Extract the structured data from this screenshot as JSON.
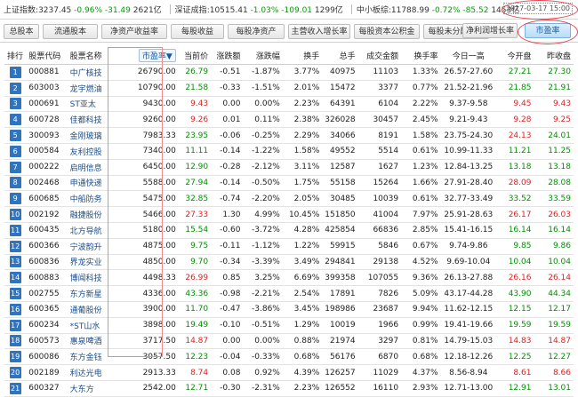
{
  "ticker": [
    {
      "name": "上证指数",
      "value": "3237.45",
      "pct": "-0.96%",
      "chg": "-31.49",
      "amount": "2621亿"
    },
    {
      "name": "深证成指",
      "value": "10515.41",
      "pct": "-1.03%",
      "chg": "-109.01",
      "amount": "1299亿"
    },
    {
      "name": "中小板综",
      "value": "11788.99",
      "pct": "-0.72%",
      "chg": "-85.52",
      "amount": "1453亿"
    }
  ],
  "datetime": "2017-03-17 15:00",
  "tabs": [
    "总股本",
    "流通股本",
    "净资产收益率",
    "每股收益",
    "每股净资产",
    "主营收入增长率",
    "每股资本公积金",
    "每股未分配利润",
    "净利润增长率",
    "市盈率"
  ],
  "active_tab": "市盈率",
  "columns": [
    "排行",
    "股票代码",
    "股票名称",
    "市盈率",
    "当前价",
    "涨跌额",
    "涨跌幅",
    "换手",
    "总手",
    "成交金额",
    "换手率",
    "今日一高",
    "今开盘",
    "昨收盘"
  ],
  "sort_indicator": "▼",
  "colors": {
    "up": "#e02020",
    "down": "#009000",
    "accent": "#2f74c0",
    "highlight": "#e2414c"
  },
  "rows": [
    {
      "rank": "1",
      "code": "000881",
      "name": "中广核技",
      "pe": "26790.00",
      "price": "26.79",
      "chg": "-0.51",
      "pct": "-1.87%",
      "turnover": "3.77%",
      "vol": "40975",
      "amount": "11103",
      "rate": "1.33%",
      "range": "26.57-27.60",
      "open": "27.21",
      "prev": "27.30",
      "pc": "green",
      "oc": "green"
    },
    {
      "rank": "2",
      "code": "603003",
      "name": "龙宇燃油",
      "pe": "10790.00",
      "price": "21.58",
      "chg": "-0.33",
      "pct": "-1.51%",
      "turnover": "2.01%",
      "vol": "15472",
      "amount": "3377",
      "rate": "0.77%",
      "range": "21.52-21.96",
      "open": "21.85",
      "prev": "21.91",
      "pc": "green",
      "oc": "green"
    },
    {
      "rank": "3",
      "code": "000691",
      "name": "ST亚太",
      "pe": "9430.00",
      "price": "9.43",
      "chg": "0.00",
      "pct": "0.00%",
      "turnover": "2.23%",
      "vol": "64391",
      "amount": "6104",
      "rate": "2.22%",
      "range": "9.37-9.58",
      "open": "9.45",
      "prev": "9.43",
      "pc": "red",
      "oc": "red"
    },
    {
      "rank": "4",
      "code": "600728",
      "name": "佳都科技",
      "pe": "9260.00",
      "price": "9.26",
      "chg": "0.01",
      "pct": "0.11%",
      "turnover": "2.38%",
      "vol": "326028",
      "amount": "30457",
      "rate": "2.45%",
      "range": "9.21-9.43",
      "open": "9.28",
      "prev": "9.25",
      "pc": "red",
      "oc": "red"
    },
    {
      "rank": "5",
      "code": "300093",
      "name": "金刚玻璃",
      "pe": "7983.33",
      "price": "23.95",
      "chg": "-0.06",
      "pct": "-0.25%",
      "turnover": "2.29%",
      "vol": "34066",
      "amount": "8191",
      "rate": "1.58%",
      "range": "23.75-24.30",
      "open": "24.13",
      "prev": "24.01",
      "pc": "green",
      "oc": "red"
    },
    {
      "rank": "6",
      "code": "000584",
      "name": "友利控股",
      "pe": "7340.00",
      "price": "11.11",
      "chg": "-0.14",
      "pct": "-1.22%",
      "turnover": "1.58%",
      "vol": "49552",
      "amount": "5514",
      "rate": "0.61%",
      "range": "10.99-11.33",
      "open": "11.21",
      "prev": "11.25",
      "pc": "green",
      "oc": "green"
    },
    {
      "rank": "7",
      "code": "000222",
      "name": "启明信息",
      "pe": "6450.00",
      "price": "12.90",
      "chg": "-0.28",
      "pct": "-2.12%",
      "turnover": "3.11%",
      "vol": "12587",
      "amount": "1627",
      "rate": "1.23%",
      "range": "12.84-13.25",
      "open": "13.18",
      "prev": "13.18",
      "pc": "green",
      "oc": "green"
    },
    {
      "rank": "8",
      "code": "002468",
      "name": "申通快递",
      "pe": "5588.00",
      "price": "27.94",
      "chg": "-0.14",
      "pct": "-0.50%",
      "turnover": "1.75%",
      "vol": "55158",
      "amount": "15264",
      "rate": "1.66%",
      "range": "27.91-28.40",
      "open": "28.09",
      "prev": "28.08",
      "pc": "green",
      "oc": "red"
    },
    {
      "rank": "9",
      "code": "600685",
      "name": "中船防务",
      "pe": "5475.00",
      "price": "32.85",
      "chg": "-0.74",
      "pct": "-2.20%",
      "turnover": "2.05%",
      "vol": "30485",
      "amount": "10039",
      "rate": "0.61%",
      "range": "32.77-33.49",
      "open": "33.52",
      "prev": "33.59",
      "pc": "green",
      "oc": "green"
    },
    {
      "rank": "10",
      "code": "002192",
      "name": "融捷股份",
      "pe": "5466.00",
      "price": "27.33",
      "chg": "1.30",
      "pct": "4.99%",
      "turnover": "10.45%",
      "vol": "151850",
      "amount": "41004",
      "rate": "7.97%",
      "range": "25.91-28.63",
      "open": "26.17",
      "prev": "26.03",
      "pc": "red",
      "oc": "red"
    },
    {
      "rank": "11",
      "code": "600435",
      "name": "北方导航",
      "pe": "5180.00",
      "price": "15.54",
      "chg": "-0.60",
      "pct": "-3.72%",
      "turnover": "4.28%",
      "vol": "425854",
      "amount": "66836",
      "rate": "2.85%",
      "range": "15.41-16.15",
      "open": "16.14",
      "prev": "16.14",
      "pc": "green",
      "oc": "green"
    },
    {
      "rank": "12",
      "code": "600366",
      "name": "宁波韵升",
      "pe": "4875.00",
      "price": "9.75",
      "chg": "-0.11",
      "pct": "-1.12%",
      "turnover": "1.22%",
      "vol": "59915",
      "amount": "5846",
      "rate": "0.67%",
      "range": "9.74-9.86",
      "open": "9.85",
      "prev": "9.86",
      "pc": "green",
      "oc": "green"
    },
    {
      "rank": "13",
      "code": "600836",
      "name": "界龙实业",
      "pe": "4850.00",
      "price": "9.70",
      "chg": "-0.34",
      "pct": "-3.39%",
      "turnover": "3.49%",
      "vol": "294841",
      "amount": "29138",
      "rate": "4.52%",
      "range": "9.69-10.04",
      "open": "10.04",
      "prev": "10.04",
      "pc": "green",
      "oc": "green"
    },
    {
      "rank": "14",
      "code": "600883",
      "name": "博闻科技",
      "pe": "4498.33",
      "price": "26.99",
      "chg": "0.85",
      "pct": "3.25%",
      "turnover": "6.69%",
      "vol": "399358",
      "amount": "107055",
      "rate": "9.36%",
      "range": "26.13-27.88",
      "open": "26.16",
      "prev": "26.14",
      "pc": "red",
      "oc": "red"
    },
    {
      "rank": "15",
      "code": "002755",
      "name": "东方新星",
      "pe": "4336.00",
      "price": "43.36",
      "chg": "-0.98",
      "pct": "-2.21%",
      "turnover": "2.54%",
      "vol": "17891",
      "amount": "7826",
      "rate": "5.09%",
      "range": "43.17-44.28",
      "open": "43.90",
      "prev": "44.34",
      "pc": "green",
      "oc": "green"
    },
    {
      "rank": "16",
      "code": "600365",
      "name": "通葡股份",
      "pe": "3900.00",
      "price": "11.70",
      "chg": "-0.47",
      "pct": "-3.86%",
      "turnover": "3.45%",
      "vol": "198986",
      "amount": "23687",
      "rate": "9.94%",
      "range": "11.62-12.15",
      "open": "12.15",
      "prev": "12.17",
      "pc": "green",
      "oc": "green"
    },
    {
      "rank": "17",
      "code": "600234",
      "name": "*ST山水",
      "pe": "3898.00",
      "price": "19.49",
      "chg": "-0.10",
      "pct": "-0.51%",
      "turnover": "1.29%",
      "vol": "10019",
      "amount": "1966",
      "rate": "0.99%",
      "range": "19.41-19.66",
      "open": "19.59",
      "prev": "19.59",
      "pc": "green",
      "oc": "green"
    },
    {
      "rank": "18",
      "code": "600573",
      "name": "惠泉啤酒",
      "pe": "3717.50",
      "price": "14.87",
      "chg": "0.00",
      "pct": "0.00%",
      "turnover": "0.88%",
      "vol": "21974",
      "amount": "3297",
      "rate": "0.81%",
      "range": "14.79-15.03",
      "open": "14.83",
      "prev": "14.87",
      "pc": "red",
      "oc": "red"
    },
    {
      "rank": "19",
      "code": "600086",
      "name": "东方金钰",
      "pe": "3057.50",
      "price": "12.23",
      "chg": "-0.04",
      "pct": "-0.33%",
      "turnover": "0.68%",
      "vol": "56176",
      "amount": "6870",
      "rate": "0.68%",
      "range": "12.18-12.26",
      "open": "12.25",
      "prev": "12.27",
      "pc": "green",
      "oc": "green"
    },
    {
      "rank": "20",
      "code": "002189",
      "name": "利达光电",
      "pe": "2913.33",
      "price": "8.74",
      "chg": "0.08",
      "pct": "0.92%",
      "turnover": "4.39%",
      "vol": "126257",
      "amount": "11029",
      "rate": "4.37%",
      "range": "8.56-8.94",
      "open": "8.61",
      "prev": "8.66",
      "pc": "red",
      "oc": "red"
    },
    {
      "rank": "21",
      "code": "600327",
      "name": "大东方",
      "pe": "2542.00",
      "price": "12.71",
      "chg": "-0.30",
      "pct": "-2.31%",
      "turnover": "2.23%",
      "vol": "126552",
      "amount": "16110",
      "rate": "2.93%",
      "range": "12.71-13.00",
      "open": "12.91",
      "prev": "13.01",
      "pc": "green",
      "oc": "green"
    }
  ]
}
